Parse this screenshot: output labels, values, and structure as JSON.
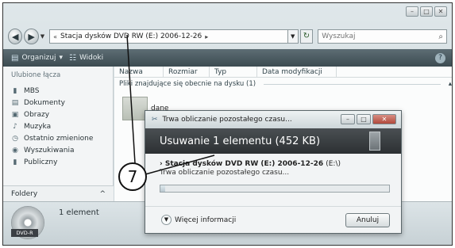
{
  "window": {
    "controls": [
      "–",
      "□",
      "✕"
    ]
  },
  "address": {
    "back_icon": "back-arrow-icon",
    "forward_icon": "forward-arrow-icon",
    "breadcrumb_prefix": "«",
    "path": "Stacja dysków DVD RW (E:) 2006-12-26",
    "path_arrow": "▸",
    "search_placeholder": "Wyszukaj"
  },
  "toolbar": {
    "organize_label": "Organizuj",
    "views_label": "Widoki"
  },
  "sidebar": {
    "favorites_title": "Ulubione łącza",
    "items": [
      {
        "label": "MBS",
        "icon": "folder-icon"
      },
      {
        "label": "Dokumenty",
        "icon": "documents-icon"
      },
      {
        "label": "Obrazy",
        "icon": "pictures-icon"
      },
      {
        "label": "Muzyka",
        "icon": "music-icon"
      },
      {
        "label": "Ostatnio zmienione",
        "icon": "recent-icon"
      },
      {
        "label": "Wyszukiwania",
        "icon": "search-folder-icon"
      },
      {
        "label": "Publiczny",
        "icon": "public-folder-icon"
      }
    ],
    "folders_label": "Foldery",
    "folders_chevron": "^"
  },
  "content": {
    "columns": [
      "Nazwa",
      "Rozmiar",
      "Typ",
      "Data modyfikacji"
    ],
    "group_title": "Pliki znajdujące się obecnie na dysku (1)",
    "items": [
      {
        "name": "dane"
      }
    ]
  },
  "details": {
    "disc_label": "DVD-R",
    "count": "1 element"
  },
  "dialog": {
    "title": "Trwa obliczanie pozostałego czasu...",
    "banner": "Usuwanie 1 elementu (452 KB)",
    "destination_bold": "Stacja dysków DVD RW (E:) 2006-12-26",
    "destination_drive": "(E:\\)",
    "status": "Trwa obliczanie pozostałego czasu...",
    "progress_fraction": 0.02,
    "more_info": "Więcej informacji",
    "cancel": "Anuluj"
  },
  "callout": {
    "number": "7"
  }
}
